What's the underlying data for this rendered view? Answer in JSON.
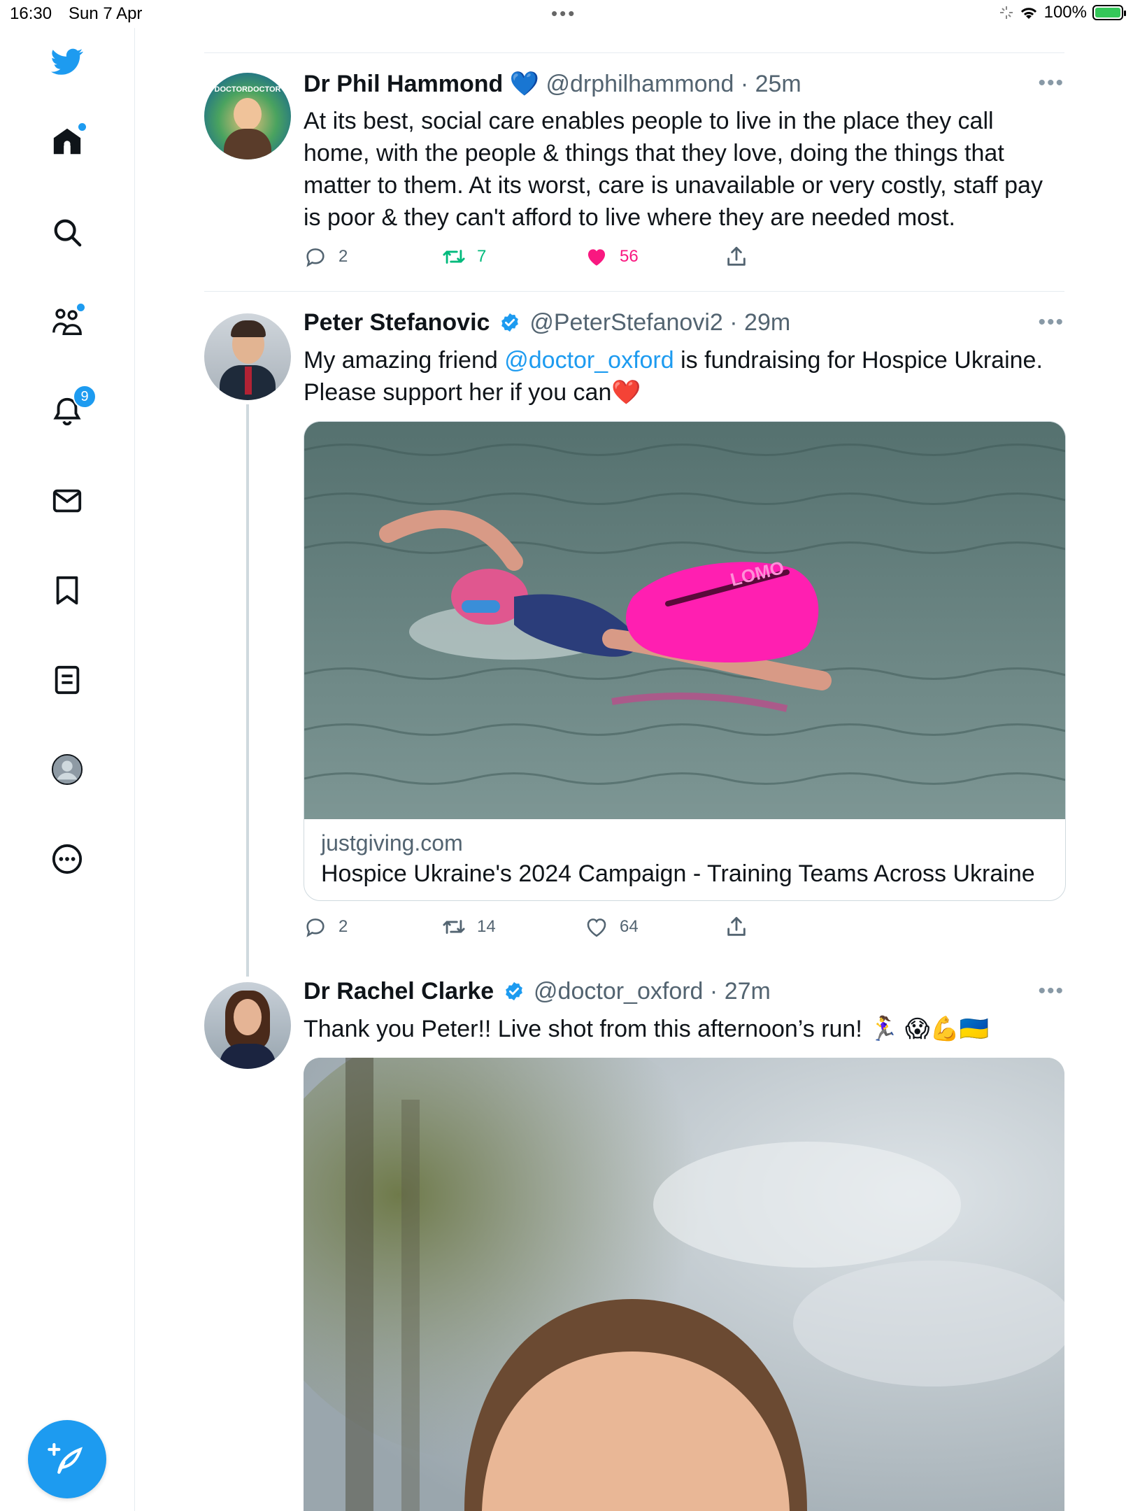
{
  "status": {
    "time": "16:30",
    "date": "Sun 7 Apr",
    "battery": "100%"
  },
  "colors": {
    "accent": "#1d9bf0",
    "like": "#f91880",
    "retweet": "#00ba7c",
    "secondary": "#536471",
    "verified": "#1d9bf0"
  },
  "sidebar": {
    "items": [
      {
        "icon": "twitter-logo-icon"
      },
      {
        "icon": "home-icon"
      },
      {
        "icon": "search-icon"
      },
      {
        "icon": "communities-icon"
      },
      {
        "icon": "notifications-icon",
        "badge": "9"
      },
      {
        "icon": "messages-icon"
      },
      {
        "icon": "bookmarks-icon"
      },
      {
        "icon": "lists-icon"
      },
      {
        "icon": "profile-icon"
      },
      {
        "icon": "more-icon"
      }
    ],
    "compose_icon": "compose-tweet-icon"
  },
  "tweets": [
    {
      "name": "Dr Phil Hammond",
      "badge_emoji": "💙",
      "handle": "@drphilhammond",
      "time": "· 25m",
      "avatar_text": "DOCTORDOCTOR",
      "text": "At its best, social care enables people to live in the place they call home, with the people & things that they love, doing the things that matter to them. At its worst, care is unavailable or very costly, staff pay is poor & they can't afford to live where they are needed most.",
      "replies": "2",
      "retweets": "7",
      "likes": "56",
      "liked": true,
      "retweeted": true
    },
    {
      "name": "Peter Stefanovic",
      "handle": "@PeterStefanovi2",
      "time": "· 29m",
      "text_before": "My amazing friend ",
      "mention": "@doctor_oxford",
      "text_after": " is fundraising for Hospice Ukraine. Please support her if you can❤️",
      "card": {
        "domain": "justgiving.com",
        "title": "Hospice Ukraine's 2024 Campaign - Training Teams Across Ukraine",
        "image_text": "LOMO"
      },
      "replies": "2",
      "retweets": "14",
      "likes": "64"
    },
    {
      "name": "Dr Rachel Clarke",
      "handle": "@doctor_oxford",
      "time": "· 27m",
      "text": "Thank you Peter!! Live shot from this afternoon’s run! 🏃‍♀️ 😱💪🇺🇦"
    }
  ]
}
